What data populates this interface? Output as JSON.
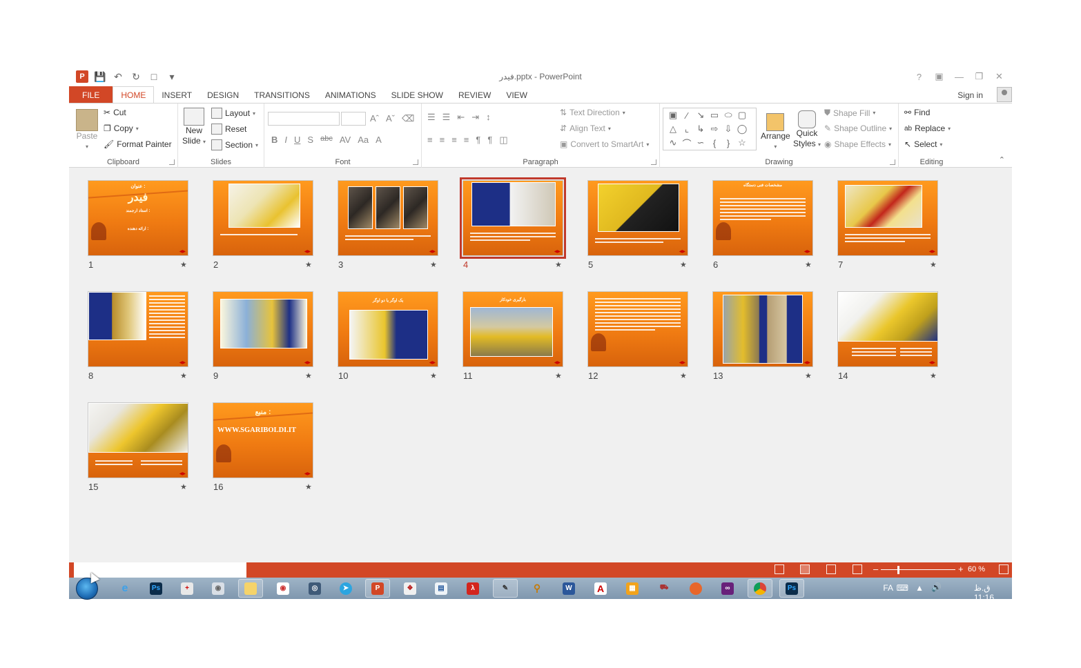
{
  "window": {
    "title": "فیدر.pptx - PowerPoint"
  },
  "tabs": [
    "FILE",
    "HOME",
    "INSERT",
    "DESIGN",
    "TRANSITIONS",
    "ANIMATIONS",
    "SLIDE SHOW",
    "REVIEW",
    "VIEW"
  ],
  "active_tab": "HOME",
  "account": {
    "sign_in": "Sign in"
  },
  "ribbon": {
    "clipboard": {
      "label": "Clipboard",
      "paste": "Paste",
      "cut": "Cut",
      "copy": "Copy",
      "format_painter": "Format Painter"
    },
    "slides": {
      "label": "Slides",
      "new_slide": "New",
      "new_slide_2": "Slide",
      "layout": "Layout",
      "reset": "Reset",
      "section": "Section"
    },
    "font": {
      "label": "Font"
    },
    "paragraph": {
      "label": "Paragraph",
      "text_direction": "Text Direction",
      "align_text": "Align Text",
      "convert_smartart": "Convert to SmartArt"
    },
    "drawing": {
      "label": "Drawing",
      "arrange": "Arrange",
      "quick_styles": "Quick",
      "quick_styles_2": "Styles",
      "shape_fill": "Shape Fill",
      "shape_outline": "Shape Outline",
      "shape_effects": "Shape Effects"
    },
    "editing": {
      "label": "Editing",
      "find": "Find",
      "replace": "Replace",
      "select": "Select"
    }
  },
  "slides": [
    {
      "n": "1",
      "title": "فیدر",
      "subtitle": "عنوان :",
      "line1": "استاد ارجمند :",
      "line2": "ارائه دهنده :"
    },
    {
      "n": "2"
    },
    {
      "n": "3"
    },
    {
      "n": "4"
    },
    {
      "n": "5"
    },
    {
      "n": "6",
      "title": "مشخصات فنی دستگاه"
    },
    {
      "n": "7"
    },
    {
      "n": "8"
    },
    {
      "n": "9"
    },
    {
      "n": "10",
      "title": "یک اوگر یا دو اوگر"
    },
    {
      "n": "11",
      "title": "بارگیری خودکار"
    },
    {
      "n": "12"
    },
    {
      "n": "13"
    },
    {
      "n": "14"
    },
    {
      "n": "15"
    },
    {
      "n": "16",
      "title": "منبع :",
      "url": "WWW.SGARIBOLDI.IT"
    }
  ],
  "selected_slide": "4",
  "status": {
    "zoom": "60 %"
  },
  "taskbar": {
    "lang": "FA",
    "time": "ق.ظ 11:16"
  },
  "colors": {
    "accent": "#d24726",
    "slide_orange": "#f07b12",
    "selection": "#c0392b"
  }
}
